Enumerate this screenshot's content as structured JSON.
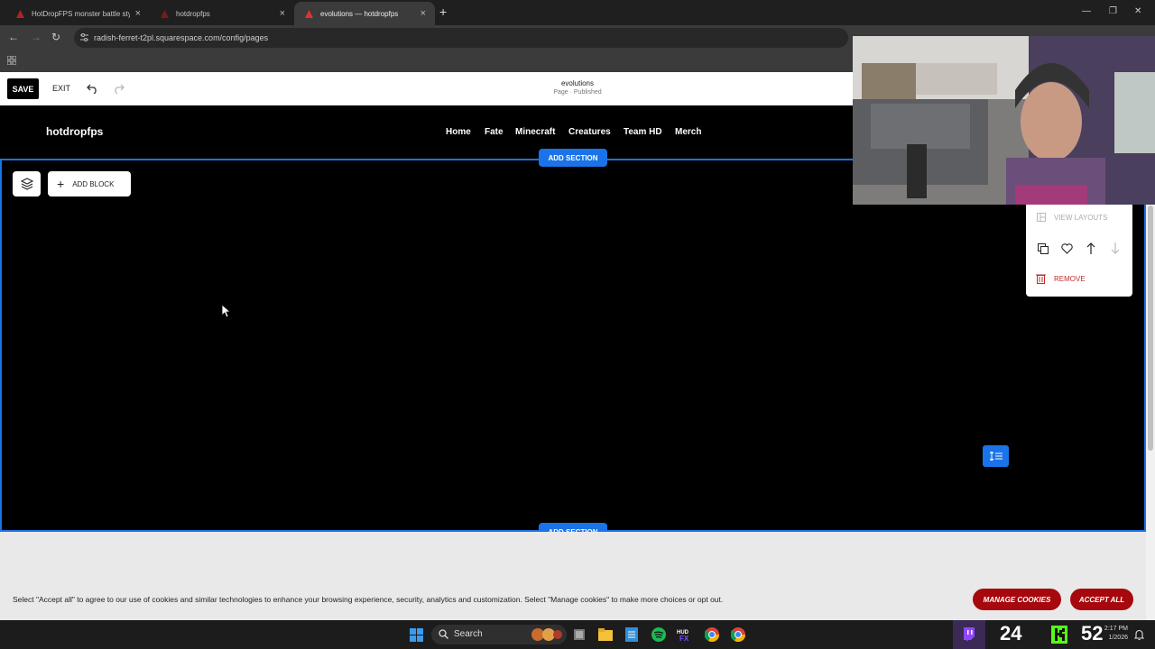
{
  "browser": {
    "tabs": [
      {
        "title": "HotDropFPS monster battle sty"
      },
      {
        "title": "hotdropfps"
      },
      {
        "title": "evolutions — hotdropfps"
      }
    ],
    "url": "radish-ferret-t2pl.squarespace.com/config/pages"
  },
  "editor": {
    "save_label": "SAVE",
    "exit_label": "EXIT",
    "page_title": "evolutions",
    "page_status": "Page · Published"
  },
  "site": {
    "logo": "hotdropfps",
    "nav": [
      "Home",
      "Fate",
      "Minecraft",
      "Creatures",
      "Team HD",
      "Merch"
    ]
  },
  "section": {
    "add_section_top": "ADD SECTION",
    "add_section_bottom": "ADD SECTION",
    "add_block": "ADD BLOCK",
    "view_layouts": "VIEW LAYOUTS",
    "remove": "REMOVE"
  },
  "cookie": {
    "text": "Select \"Accept all\" to agree to our use of cookies and similar technologies to enhance your browsing experience, security, analytics and customization. Select \"Manage cookies\" to make more choices or opt out.",
    "manage_label": "MANAGE COOKIES",
    "accept_label": "ACCEPT ALL"
  },
  "taskbar": {
    "search_label": "Search",
    "widget_count_1": "24",
    "widget_count_2": "52",
    "time": "2:17 PM",
    "date": "1/2026"
  },
  "colors": {
    "accent": "#1a73e8",
    "cookie_button": "#a6080e",
    "site_bg": "#000000"
  }
}
